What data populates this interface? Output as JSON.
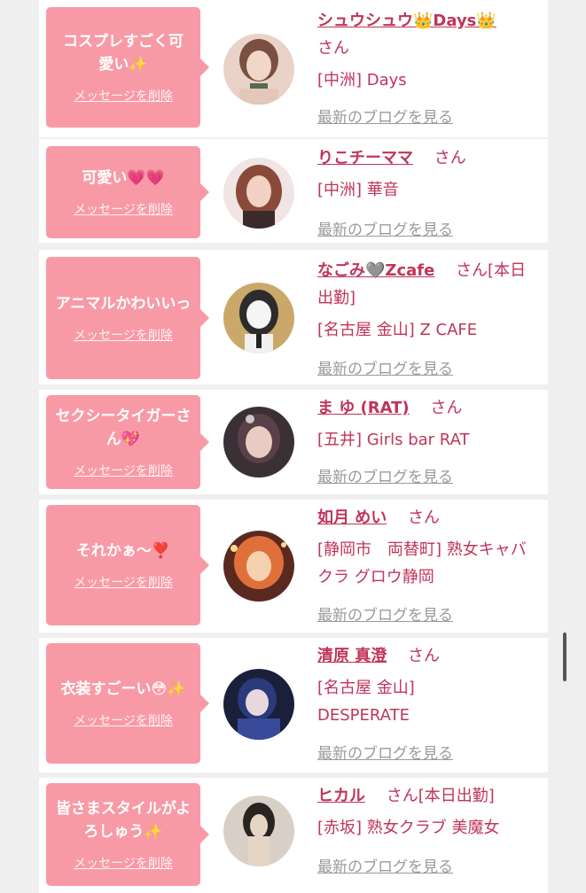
{
  "cards": [
    {
      "message": "コスプレすごく可愛い✨",
      "delete_label": "メッセージを削除",
      "name": "シュウシュウ👑Days👑",
      "san": "さん",
      "shop": "[中洲] Days",
      "blog_label": "最新のブログを見る",
      "avatar_colors": [
        "#e9d3c8",
        "#7a5040",
        "#f2d6c8"
      ]
    },
    {
      "message": "可愛い💗💗",
      "delete_label": "メッセージを削除",
      "name": "りこチーママ",
      "san": "さん",
      "shop": "[中洲] 華音",
      "blog_label": "最新のブログを見る",
      "avatar_colors": [
        "#f0e4e4",
        "#8a4a3a",
        "#f3d2c6"
      ]
    },
    {
      "message": "アニマルかわいいっ",
      "delete_label": "メッセージを削除",
      "name": "なごみ🩶Zcafe",
      "san": "さん[本日出勤]",
      "shop": "[名古屋 金山] Z CAFE",
      "blog_label": "最新のブログを見る",
      "avatar_colors": [
        "#c9a86a",
        "#2c2c2c",
        "#f5f5f5"
      ]
    },
    {
      "message": "セクシータイガーさん💖",
      "delete_label": "メッセージを削除",
      "name": "ま ゆ (RAT)",
      "san": "さん",
      "shop": "[五井] Girls bar RAT",
      "blog_label": "最新のブログを見る",
      "avatar_colors": [
        "#3a3036",
        "#5a4048",
        "#e8ccc2"
      ]
    },
    {
      "message": "それかぁ〜❣️",
      "delete_label": "メッセージを削除",
      "name": "如月 めい",
      "san": "さん",
      "shop": "[静岡市　両替町] 熟女キャバクラ グロウ静岡",
      "blog_label": "最新のブログを見る",
      "avatar_colors": [
        "#5a2a20",
        "#e0703a",
        "#f4d2b0"
      ]
    },
    {
      "message": "衣装すごーい😳✨",
      "delete_label": "メッセージを削除",
      "name": "清原 真澄",
      "san": "さん",
      "shop": "[名古屋 金山] DESPERATE",
      "blog_label": "最新のブログを見る",
      "avatar_colors": [
        "#1a1f3a",
        "#2a3a7a",
        "#e8d8de"
      ]
    },
    {
      "message": "皆さまスタイルがよろしゅう✨",
      "delete_label": "メッセージを削除",
      "name": "ヒカル",
      "san": "さん[本日出勤]",
      "shop": "[赤坂] 熟女クラブ 美魔女",
      "blog_label": "最新のブログを見る",
      "avatar_colors": [
        "#d8cfc6",
        "#2a2420",
        "#e6d4c4"
      ]
    }
  ],
  "colors": {
    "accent": "#c0355a",
    "bubble": "#f89aa6",
    "link_gray": "#9a9a9a",
    "background": "#efefef"
  }
}
